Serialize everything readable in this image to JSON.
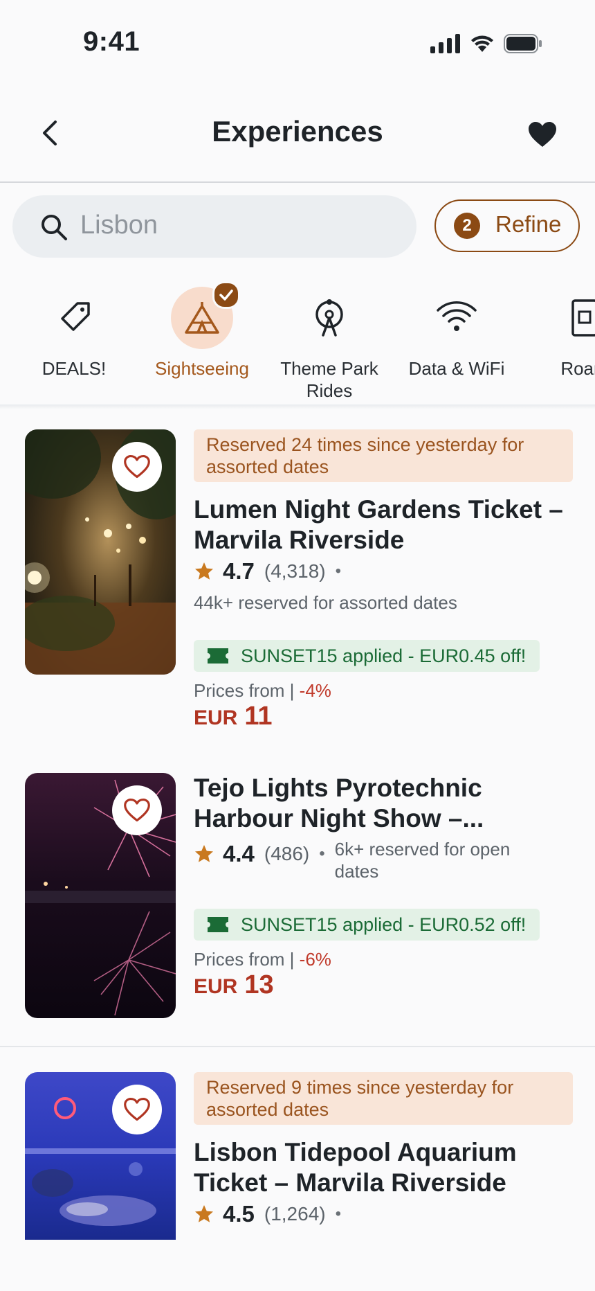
{
  "status": {
    "time": "9:41"
  },
  "nav": {
    "title": "Experiences"
  },
  "search": {
    "placeholder": "Lisbon"
  },
  "refine": {
    "count": "2",
    "label": "Refine"
  },
  "categories": [
    {
      "label": "DEALS!",
      "icon": "tag-icon",
      "active": false
    },
    {
      "label": "Sightseeing",
      "icon": "tent-icon",
      "active": true
    },
    {
      "label": "Theme Park Rides",
      "icon": "ferris-wheel-icon",
      "active": false
    },
    {
      "label": "Data & WiFi",
      "icon": "wifi-icon",
      "active": false
    },
    {
      "label": "Roam",
      "icon": "sim-card-icon",
      "active": false
    }
  ],
  "listings": [
    {
      "banner": "Reserved 24 times since yesterday for assorted dates",
      "title": "Lumen Night Gardens Ticket – Marvila Riverside",
      "rating": "4.7",
      "reviews": "(4,318)",
      "reserved": "44k+ reserved for assorted dates",
      "promo": "SUNSET15 applied - EUR0.45 off!",
      "price_from": "Prices from | ",
      "discount": "-4%",
      "currency": "EUR",
      "price": "11"
    },
    {
      "banner": "",
      "title": "Tejo Lights Pyrotechnic Harbour Night Show –...",
      "rating": "4.4",
      "reviews": "(486)",
      "reserved": "6k+ reserved for open dates",
      "promo": "SUNSET15 applied - EUR0.52 off!",
      "price_from": "Prices from | ",
      "discount": "-6%",
      "currency": "EUR",
      "price": "13"
    },
    {
      "banner": "Reserved 9 times since yesterday for assorted dates",
      "title": "Lisbon Tidepool Aquarium Ticket – Marvila Riverside",
      "rating": "4.5",
      "reviews": "(1,264)",
      "reserved": "",
      "promo": "",
      "price_from": "",
      "discount": "",
      "currency": "",
      "price": ""
    }
  ],
  "colors": {
    "accent": "#8b4a14",
    "promo_green": "#1b6b36",
    "price_red": "#b03522",
    "star": "#c9791f"
  }
}
